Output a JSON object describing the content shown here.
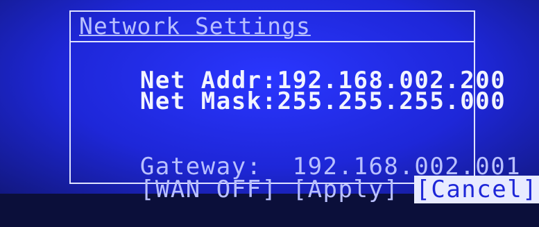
{
  "screen": {
    "title": "Network Settings",
    "net_addr": {
      "label": "Net Addr:",
      "value": "192.168.002.200"
    },
    "net_mask": {
      "label": "Net Mask:",
      "value": "255.255.255.000"
    },
    "gateway": {
      "label": "Gateway: ",
      "value": "192.168.002.001"
    },
    "buttons": {
      "wan": "[WAN OFF]",
      "apply": "[Apply]",
      "cancel": "[Cancel]"
    },
    "colors": {
      "background": "#1e27d8",
      "text": "#f2f4ff",
      "dim_text": "#b9c0ff"
    }
  }
}
